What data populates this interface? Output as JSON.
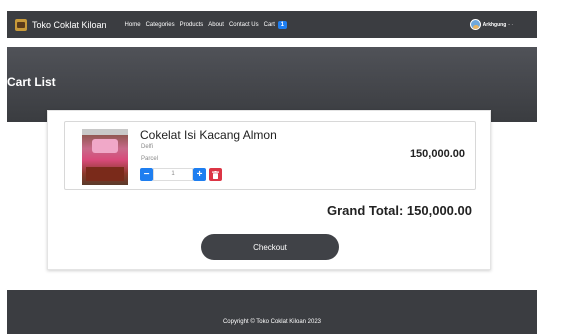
{
  "navbar": {
    "brand": "Toko Coklat Kiloan",
    "links": [
      "Home",
      "Categories",
      "Products",
      "About",
      "Contact Us",
      "Cart"
    ],
    "cart_count": "1",
    "user_name": "Arkhgung",
    "user_caret": "- ·"
  },
  "page": {
    "title": "Cart List"
  },
  "cart": {
    "items": [
      {
        "name": "Cokelat Isi Kacang Almon",
        "brand": "Delfi",
        "category": "Parcel",
        "quantity": "1",
        "price": "150,000.00"
      }
    ],
    "grand_total_label": "Grand Total: 150,000.00",
    "checkout_label": "Checkout"
  },
  "footer": {
    "copyright": "Copyright © Toko Coklat Kiloan 2023"
  },
  "colors": {
    "nav_bg": "#3b3d41",
    "accent_blue": "#1e7ef0",
    "danger_red": "#dc3545"
  },
  "icons": [
    "brand-logo-icon",
    "avatar-icon",
    "minus-icon",
    "plus-icon",
    "trash-icon"
  ]
}
